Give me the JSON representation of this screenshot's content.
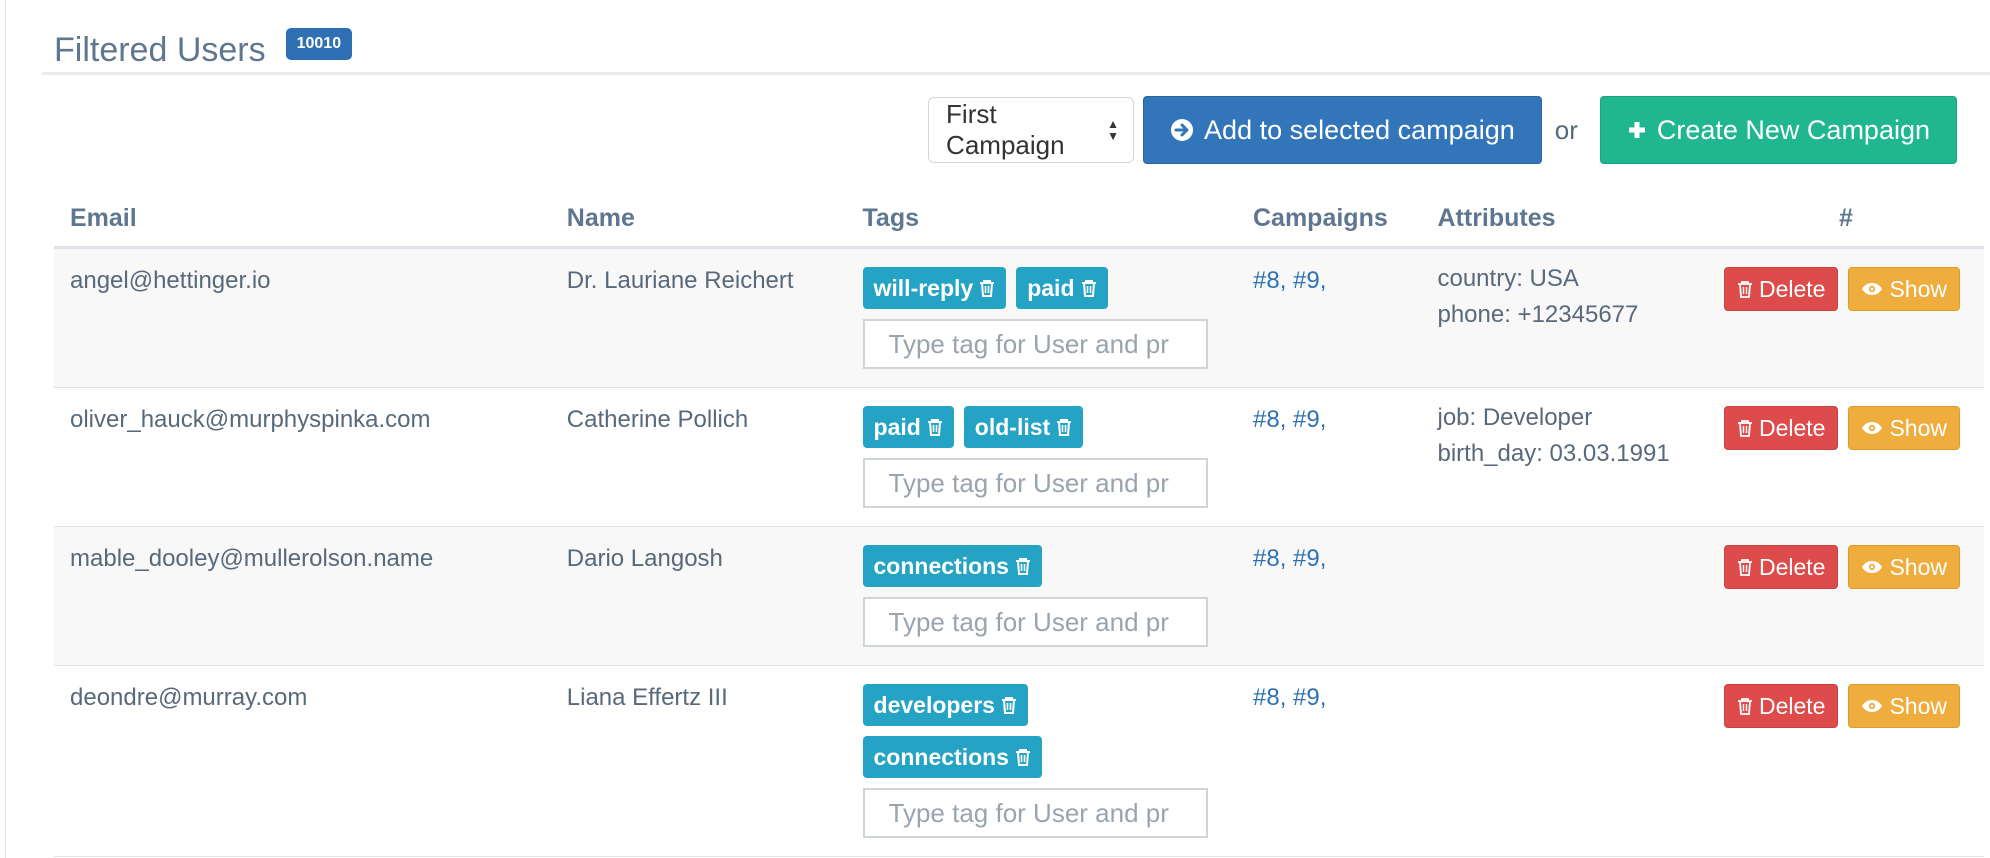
{
  "header": {
    "title": "Filtered Users",
    "count": "10010"
  },
  "actions": {
    "selected_campaign": "First Campaign",
    "add_label": "Add to selected campaign",
    "or_label": "or",
    "create_label": "Create New Campaign"
  },
  "columns": {
    "email": "Email",
    "name": "Name",
    "tags": "Tags",
    "campaigns": "Campaigns",
    "attributes": "Attributes",
    "actions": "#"
  },
  "tag_placeholder": "Type tag for User and pr",
  "row_buttons": {
    "delete": "Delete",
    "show": "Show"
  },
  "users": [
    {
      "email": "angel@hettinger.io",
      "name": "Dr. Lauriane Reichert",
      "tags": [
        "will-reply",
        "paid"
      ],
      "campaigns": "#8, #9,",
      "attributes": [
        "country: USA",
        "phone: +12345677"
      ]
    },
    {
      "email": "oliver_hauck@murphyspinka.com",
      "name": "Catherine Pollich",
      "tags": [
        "paid",
        "old-list"
      ],
      "campaigns": "#8, #9,",
      "attributes": [
        "job: Developer",
        "birth_day: 03.03.1991"
      ]
    },
    {
      "email": "mable_dooley@mullerolson.name",
      "name": "Dario Langosh",
      "tags": [
        "connections"
      ],
      "campaigns": "#8, #9,",
      "attributes": []
    },
    {
      "email": "deondre@murray.com",
      "name": "Liana Effertz III",
      "tags": [
        "developers",
        "connections"
      ],
      "campaigns": "#8, #9,",
      "attributes": []
    }
  ],
  "colors": {
    "primary": "#3276b9",
    "success": "#1fb690",
    "danger": "#dd4b4a",
    "warning": "#efad3e",
    "tag": "#25a3c5",
    "link": "#2d71b4"
  },
  "icons": {
    "add": "circle-arrow-right-icon",
    "create": "plus-icon",
    "trash": "trash-icon",
    "show": "eye-icon"
  }
}
